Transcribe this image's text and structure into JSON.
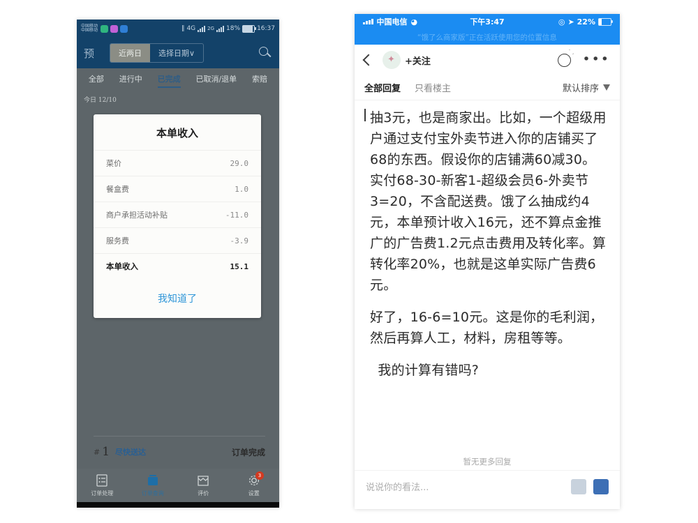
{
  "left_phone": {
    "status_bar": {
      "carrier_line1": "中国移动",
      "carrier_line2": "中国移动",
      "network_4g": "4G",
      "network_4g_sup": "4G",
      "network_2g": "2G",
      "battery_percent": "18%",
      "clock": "16:37",
      "icons": [
        "headphone-icon",
        "vibrate-icon"
      ]
    },
    "title_bar": {
      "title": "预",
      "segment": [
        {
          "label": "近两日",
          "active": true
        },
        {
          "label": "选择日期∨",
          "active": false
        }
      ],
      "search_icon": "search-icon"
    },
    "tabs": [
      {
        "label": "全部",
        "active": false
      },
      {
        "label": "进行中",
        "active": false
      },
      {
        "label": "已完成",
        "active": true
      },
      {
        "label": "已取消/退单",
        "active": false
      },
      {
        "label": "索赔",
        "active": false
      }
    ],
    "day_label": "今日  12/10",
    "card": {
      "title": "本单收入",
      "rows": [
        {
          "key": "菜价",
          "value": "29.0"
        },
        {
          "key": "餐盒费",
          "value": "1.0"
        },
        {
          "key": "商户承担活动补贴",
          "value": "-11.0"
        },
        {
          "key": "服务费",
          "value": "-3.9"
        }
      ],
      "total": {
        "key": "本单收入",
        "value": "15.1"
      },
      "confirm_label": "我知道了"
    },
    "order_row": {
      "hash": "#",
      "number": "1",
      "delivery": "尽快送达",
      "status": "订单完成"
    },
    "bottom_nav": [
      {
        "label": "订单处理",
        "icon": "order-list-icon",
        "active": false,
        "badge": ""
      },
      {
        "label": "订单查询",
        "icon": "order-box-icon",
        "active": true,
        "badge": ""
      },
      {
        "label": "评价",
        "icon": "shop-icon",
        "active": false,
        "badge": ""
      },
      {
        "label": "设置",
        "icon": "gear-icon",
        "active": false,
        "badge": "3"
      }
    ],
    "system_nav": [
      "back-triangle-icon",
      "home-circle-icon",
      "recents-square-icon"
    ]
  },
  "right_phone": {
    "status_bar": {
      "carrier": "中国电信",
      "time": "下午3:47",
      "battery_percent": "22%",
      "icons": [
        "wifi-icon",
        "location-icon",
        "navigation-arrow-icon"
      ]
    },
    "location_banner": "“饿了么商家版”正在活跃使用您的位置信息",
    "nav_bar": {
      "back_icon": "back-chevron-icon",
      "avatar": "user-avatar",
      "follow_label": "+关注",
      "share_icon": "share-icon",
      "more_icon": "more-dots-icon"
    },
    "filter_bar": {
      "items": [
        {
          "label": "全部回复",
          "active": true
        },
        {
          "label": "只看楼主",
          "active": false
        }
      ],
      "sort_label": "默认排序",
      "sort_icon": "funnel-icon"
    },
    "post": {
      "paragraphs": [
        "抽3元，也是商家出。比如，一个超级用户通过支付宝外卖节进入你的店铺买了68的东西。假设你的店铺满60减30。实付68-30-新客1-超级会员6-外卖节3=20，不含配送费。饿了么抽成约4元，本单预计收入16元，还不算点金推广的广告费1.2元点击费用及转化率。算转化率20%，也就是这单实际广告费6元。",
        "好了，16-6=10元。这是你的毛利润，然后再算人工，材料，房租等等。",
        "我的计算有错吗?"
      ]
    },
    "no_more_label": "暂无更多回复",
    "input_bar": {
      "placeholder": "说说你的看法...",
      "icons": [
        "emoji-icon",
        "avatar-icon"
      ]
    }
  },
  "colors": {
    "android_header": "#134269",
    "android_dim": "#5d6569",
    "ios_blue": "#1b8cf2",
    "accent_link": "#2f96d8",
    "badge_red": "#d33a21"
  }
}
